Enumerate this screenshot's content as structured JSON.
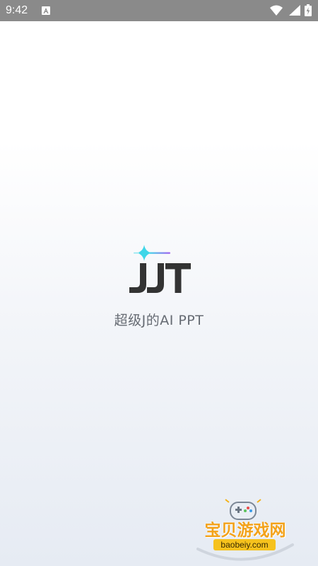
{
  "status_bar": {
    "time": "9:42",
    "icons": [
      "a-notification-icon",
      "wifi-icon",
      "signal-icon",
      "battery-icon"
    ]
  },
  "splash": {
    "logo_text": "JJT",
    "tagline": "超级J的AI PPT",
    "colors": {
      "logo": "#333333",
      "sparkle_cyan": "#3fd6e8",
      "sparkle_purple": "#a05cf0",
      "tagline": "#666b73"
    }
  },
  "watermark": {
    "title": "宝贝游戏网",
    "url": "baobeiy.com",
    "icon": "gamepad-icon"
  }
}
